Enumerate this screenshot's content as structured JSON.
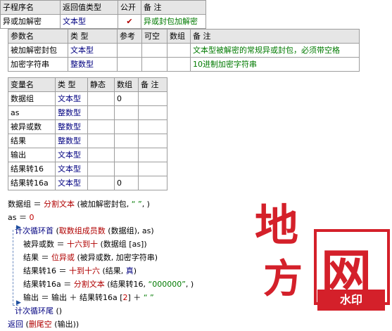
{
  "sub_table": {
    "headers": [
      "子程序名",
      "返回值类型",
      "公开",
      "备 注"
    ],
    "row": {
      "name": "异或加解密",
      "type": "文本型",
      "public": "✔",
      "comment": "异或封包加解密"
    }
  },
  "param_table": {
    "headers": [
      "参数名",
      "类 型",
      "参考",
      "可空",
      "数组",
      "备 注"
    ],
    "rows": [
      {
        "name": "被加解密封包",
        "type": "文本型",
        "comment": "文本型被解密的常规异或封包，必须带空格"
      },
      {
        "name": "加密字符串",
        "type": "整数型",
        "comment": "10进制加密字符串"
      }
    ]
  },
  "var_table": {
    "headers": [
      "变量名",
      "类 型",
      "静态",
      "数组",
      "备 注"
    ],
    "rows": [
      {
        "name": "数据组",
        "type": "文本型",
        "array": "0"
      },
      {
        "name": "as",
        "type": "整数型",
        "array": ""
      },
      {
        "name": "被异或数",
        "type": "整数型",
        "array": ""
      },
      {
        "name": "结果",
        "type": "整数型",
        "array": ""
      },
      {
        "name": "输出",
        "type": "文本型",
        "array": ""
      },
      {
        "name": "结果转16",
        "type": "文本型",
        "array": ""
      },
      {
        "name": "结果转16a",
        "type": "文本型",
        "array": "0"
      }
    ]
  },
  "code": {
    "l1": {
      "a": "数据组 ＝ ",
      "b": "分割文本",
      "c": " (被加解密封包, ",
      "d": "“ ”",
      "e": ", )"
    },
    "l2": {
      "a": "as ＝ ",
      "b": "0"
    },
    "l3": {
      "a": "计次循环首",
      "b": " (",
      "c": "取数组成员数",
      "d": " (数据组), as)"
    },
    "l4": {
      "a": "被异或数 ＝ ",
      "b": "十六到十",
      "c": " (数据组 [as])"
    },
    "l5": {
      "a": "结果 ＝ ",
      "b": "位异或",
      "c": " (被异或数, 加密字符串)"
    },
    "l6": {
      "a": "结果转16 ＝ ",
      "b": "十到十六",
      "c": " (结果, ",
      "d": "真",
      "e": ")"
    },
    "l7": {
      "a": "结果转16a ＝ ",
      "b": "分割文本",
      "c": " (结果转16, ",
      "d": "“000000”",
      "e": ", )"
    },
    "l8": {
      "a": "输出 ＝ 输出 ＋ 结果转16a [",
      "b": "2",
      "c": "] ＋ ",
      "d": "“ ”"
    },
    "l9": {
      "a": "计次循环尾",
      "b": " ()"
    },
    "l10": {
      "a": "返回",
      "b": " (",
      "c": "删尾空",
      "d": " (输出))"
    }
  },
  "watermark": {
    "char1": "地",
    "char2": "方",
    "char3": "网",
    "badge": "水印",
    "color": "#d4202a"
  }
}
